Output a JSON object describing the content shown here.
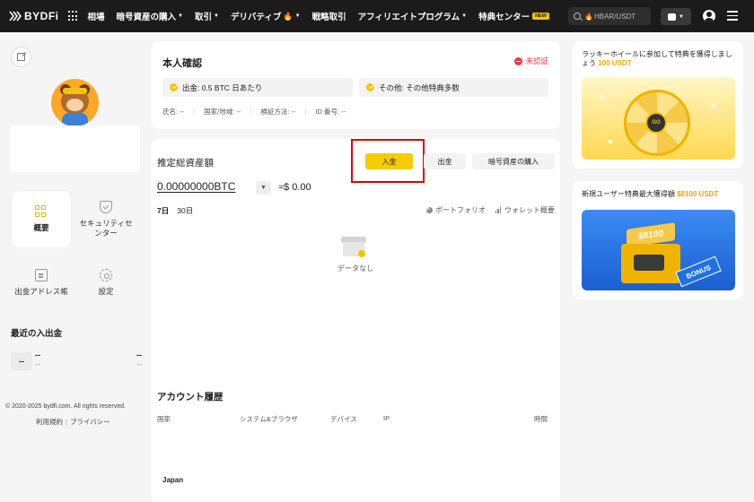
{
  "header": {
    "brand": "BYDFi",
    "nav": [
      {
        "label": "相場",
        "caret": false
      },
      {
        "label": "暗号資産の購入",
        "caret": true
      },
      {
        "label": "取引",
        "caret": true
      },
      {
        "label": "デリバティブ",
        "caret": true,
        "fire": true
      },
      {
        "label": "戦略取引",
        "caret": false
      },
      {
        "label": "アフィリエイトプログラム",
        "caret": true
      },
      {
        "label": "特典センター",
        "caret": false,
        "badge": "NEW"
      }
    ],
    "search_text": "HBAR/USDT"
  },
  "sidebar": {
    "tiles": [
      {
        "label": "概要",
        "icon": "overview-grid-icon"
      },
      {
        "label": "セキュリティセンター",
        "icon": "shield-icon"
      },
      {
        "label": "出金アドレス帳",
        "icon": "address-book-icon"
      },
      {
        "label": "設定",
        "icon": "gear-icon"
      }
    ],
    "recent_title": "最近の入出金",
    "recent": {
      "badge": "--",
      "a": "--",
      "b": "--",
      "c": "--",
      "d": "--"
    },
    "copyright": "© 2020-2025 bydfi.com. All rights reserved.",
    "terms": "利用規約",
    "privacy": "プライバシー"
  },
  "kyc": {
    "title": "本人確認",
    "status": "未認証",
    "perk1": "出金: 0.5 BTC 日あたり",
    "perk2": "その他: その他特典多数",
    "fields": [
      "氏名: --",
      "国家/地域: --",
      "検証方法: --",
      "ID 番号: --"
    ]
  },
  "assets": {
    "title": "推定総資産額",
    "deposit": "入金",
    "withdraw": "出金",
    "buy": "暗号資産の購入",
    "balance": "0.00000000BTC",
    "usd": "≈$ 0.00",
    "range_7": "7日",
    "range_30": "30日",
    "portfolio": "ポートフォリオ",
    "wallet": "ウォレット概要",
    "empty": "データなし"
  },
  "history": {
    "title": "アカウント履歴",
    "cols": [
      "国家",
      "システム&ブラウザ",
      "デバイス",
      "IP",
      "時間"
    ],
    "first_cell": "Japan"
  },
  "promos": {
    "p1_text": "ラッキーホイールに参加して特典を獲得しましょう",
    "p1_hl": "100 USDT",
    "p2_text": "新規ユーザー特典最大獲得額",
    "p2_hl": "$8100 USDT",
    "wheel_center": "GO",
    "gift_value": "$8100",
    "bonus": "BONUS"
  },
  "colors": {
    "accent": "#f5cc00",
    "danger": "#e53935",
    "highlight": "#e00000"
  }
}
